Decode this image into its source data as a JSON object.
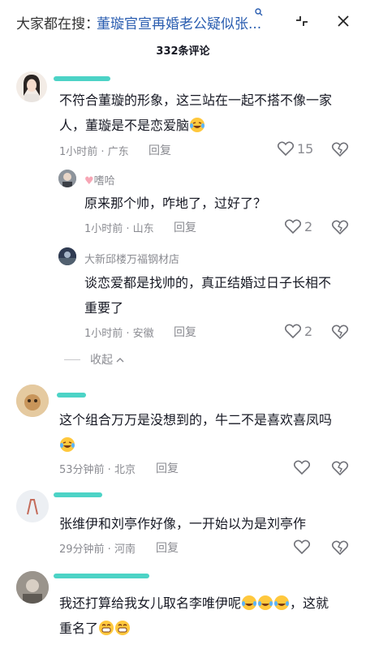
{
  "topbar": {
    "prefix": "大家都在搜：",
    "query": "董璇官宣再婚老公疑似张",
    "ellipsis": "...",
    "query_end_icon": "search-icon",
    "collapse_icon": "minimize-icon",
    "close_icon": "close-icon"
  },
  "comment_count": "332条评论",
  "comments": [
    {
      "name": "",
      "text_line1": "不符合董璇的形象，这三站在一起不搭不像一家",
      "text_line2": "人，董璇是不是恋爱脑",
      "meta": "1小时前 · 广东",
      "reply": "回复",
      "likes": "15"
    },
    {
      "name": "嗜哈",
      "text_line1": "原来那个帅，咋地了，过好了？",
      "meta": "1小时前 · 山东",
      "reply": "回复",
      "likes": "2"
    },
    {
      "name": "大新邱楼万福钢材店",
      "text_line1": "谈恋爱都是找帅的，真正结婚过日子长相不",
      "text_line2": "重要了",
      "meta": "1小时前 · 安徽",
      "reply": "回复",
      "likes": "2"
    },
    {
      "name": "",
      "text_line1": "这个组合万万是没想到的，牛二不是喜欢喜凤吗",
      "meta": "53分钟前 · 北京",
      "reply": "回复",
      "likes": ""
    },
    {
      "name": "",
      "text_line1": "张维伊和刘亭作好像，一开始以为是刘亭作",
      "meta": "29分钟前 · 河南",
      "reply": "回复",
      "likes": ""
    },
    {
      "name": "",
      "text_line1": "我还打算给我女儿取名李唯伊呢",
      "text_line1_tail": "，这就",
      "text_line2": "重名了",
      "meta": "",
      "reply": "",
      "likes": ""
    }
  ],
  "collapse": {
    "label": "收起"
  }
}
